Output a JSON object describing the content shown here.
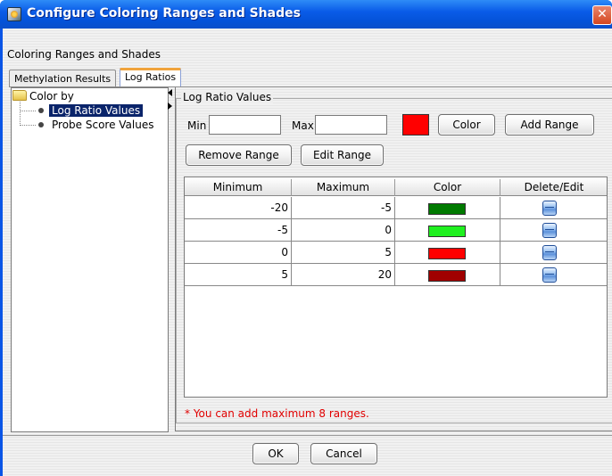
{
  "window": {
    "title": "Configure Coloring Ranges and Shades",
    "close_label": "✕"
  },
  "header": {
    "section_label": "Coloring Ranges and Shades"
  },
  "tabs": [
    {
      "label": "Methylation Results",
      "selected": false
    },
    {
      "label": "Log Ratios",
      "selected": true
    }
  ],
  "tree": {
    "root": "Color by",
    "items": [
      {
        "label": "Log Ratio Values",
        "selected": true
      },
      {
        "label": "Probe Score Values",
        "selected": false
      }
    ]
  },
  "group": {
    "title": "Log Ratio Values",
    "min_label": "Min",
    "min_value": "",
    "max_label": "Max",
    "max_value": "",
    "selected_color": "#ff0000",
    "color_button": "Color",
    "add_range_button": "Add Range",
    "remove_range_button": "Remove Range",
    "edit_range_button": "Edit Range"
  },
  "table": {
    "columns": [
      "Minimum",
      "Maximum",
      "Color",
      "Delete/Edit"
    ],
    "rows": [
      {
        "min": "-20",
        "max": "-5",
        "color": "#007a00"
      },
      {
        "min": "-5",
        "max": "0",
        "color": "#1ff01f"
      },
      {
        "min": "0",
        "max": "5",
        "color": "#ff0000"
      },
      {
        "min": "5",
        "max": "20",
        "color": "#a00000"
      }
    ],
    "edit_icon": "edit-icon"
  },
  "note": "* You can add maximum 8 ranges.",
  "footer": {
    "ok": "OK",
    "cancel": "Cancel"
  }
}
